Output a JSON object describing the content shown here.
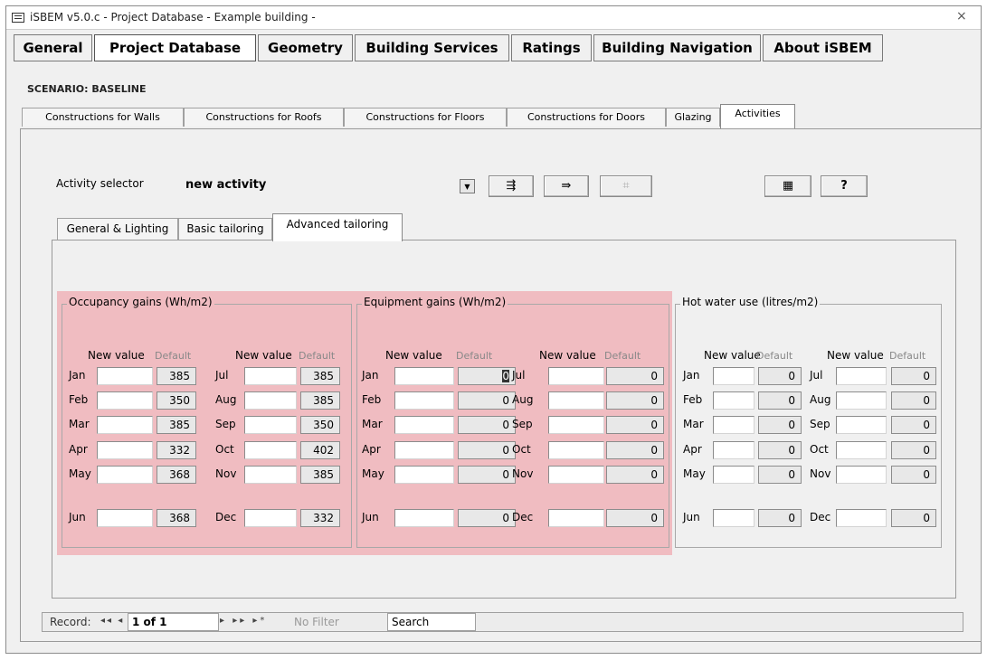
{
  "window": {
    "title": "iSBEM v5.0.c - Project Database - Example building -",
    "close_glyph": "×"
  },
  "main_tabs": [
    "General",
    "Project Database",
    "Geometry",
    "Building Services",
    "Ratings",
    "Building Navigation",
    "About iSBEM"
  ],
  "scenario": "SCENARIO: BASELINE",
  "sub_tabs": [
    "Constructions for Walls",
    "Constructions for Roofs",
    "Constructions for Floors",
    "Constructions for Doors",
    "Glazing",
    "Activities"
  ],
  "activity": {
    "label": "Activity selector",
    "value": "new activity",
    "combo_arrow": "▼"
  },
  "toolbar": {
    "btn1": "⇶",
    "btn2": "⇛",
    "btn3": "⌗",
    "btn4": "▦",
    "btn5": "?"
  },
  "inner_tabs": [
    "General & Lighting",
    "Basic tailoring",
    "Advanced tailoring"
  ],
  "groups": {
    "col_new": "New value",
    "col_default": "Default",
    "occupancy": {
      "title": "Occupancy gains (Wh/m2)",
      "left": [
        {
          "m": "Jan",
          "d": "385"
        },
        {
          "m": "Feb",
          "d": "350"
        },
        {
          "m": "Mar",
          "d": "385"
        },
        {
          "m": "Apr",
          "d": "332"
        },
        {
          "m": "May",
          "d": "368"
        },
        {
          "m": "Jun",
          "d": "368"
        }
      ],
      "right": [
        {
          "m": "Jul",
          "d": "385"
        },
        {
          "m": "Aug",
          "d": "385"
        },
        {
          "m": "Sep",
          "d": "350"
        },
        {
          "m": "Oct",
          "d": "402"
        },
        {
          "m": "Nov",
          "d": "385"
        },
        {
          "m": "Dec",
          "d": "332"
        }
      ]
    },
    "equipment": {
      "title": "Equipment gains (Wh/m2)",
      "left": [
        {
          "m": "Jan",
          "d": "0"
        },
        {
          "m": "Feb",
          "d": "0"
        },
        {
          "m": "Mar",
          "d": "0"
        },
        {
          "m": "Apr",
          "d": "0"
        },
        {
          "m": "May",
          "d": "0"
        },
        {
          "m": "Jun",
          "d": "0"
        }
      ],
      "right": [
        {
          "m": "Jul",
          "d": "0"
        },
        {
          "m": "Aug",
          "d": "0"
        },
        {
          "m": "Sep",
          "d": "0"
        },
        {
          "m": "Oct",
          "d": "0"
        },
        {
          "m": "Nov",
          "d": "0"
        },
        {
          "m": "Dec",
          "d": "0"
        }
      ]
    },
    "hotwater": {
      "title": "Hot water use (litres/m2)",
      "left": [
        {
          "m": "Jan",
          "d": "0"
        },
        {
          "m": "Feb",
          "d": "0"
        },
        {
          "m": "Mar",
          "d": "0"
        },
        {
          "m": "Apr",
          "d": "0"
        },
        {
          "m": "May",
          "d": "0"
        },
        {
          "m": "Jun",
          "d": "0"
        }
      ],
      "right": [
        {
          "m": "Jul",
          "d": "0"
        },
        {
          "m": "Aug",
          "d": "0"
        },
        {
          "m": "Sep",
          "d": "0"
        },
        {
          "m": "Oct",
          "d": "0"
        },
        {
          "m": "Nov",
          "d": "0"
        },
        {
          "m": "Dec",
          "d": "0"
        }
      ]
    }
  },
  "record_bar": {
    "label": "Record:",
    "nav_first_prev": "◂◂ ◂",
    "value": "1 of 1",
    "nav_next_last": "▸ ▸▸ ▸*",
    "filter": "No Filter",
    "search": "Search"
  },
  "colors": {
    "highlight": "#f0bcc1"
  }
}
